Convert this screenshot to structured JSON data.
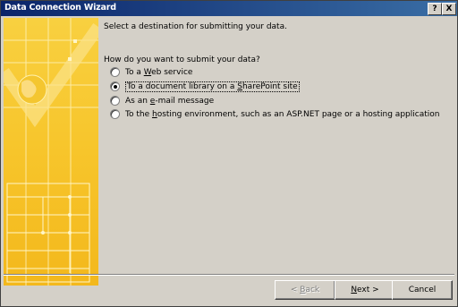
{
  "window": {
    "title": "Data Connection Wizard"
  },
  "titlebar": {
    "help": "?",
    "close": "X"
  },
  "intro": "Select a destination for submitting your data.",
  "question": "How do you want to submit your data?",
  "options": [
    {
      "pre": "To a ",
      "key": "W",
      "post": "eb service",
      "checked": false
    },
    {
      "pre": "To a document library on a ",
      "key": "S",
      "post": "harePoint site",
      "checked": true
    },
    {
      "pre": "As an ",
      "key": "e",
      "post": "-mail message",
      "checked": false
    },
    {
      "pre": "To the ",
      "key": "h",
      "post": "osting environment, such as an ASP.NET page or a hosting application",
      "checked": false
    }
  ],
  "buttons": {
    "back": {
      "pre": "< ",
      "key": "B",
      "post": "ack"
    },
    "next": {
      "pre": "",
      "key": "N",
      "post": "ext >"
    },
    "cancel": "Cancel"
  },
  "colors": {
    "accent": "#0a246a",
    "banner": "#f7c52b",
    "face": "#d4d0c8"
  }
}
